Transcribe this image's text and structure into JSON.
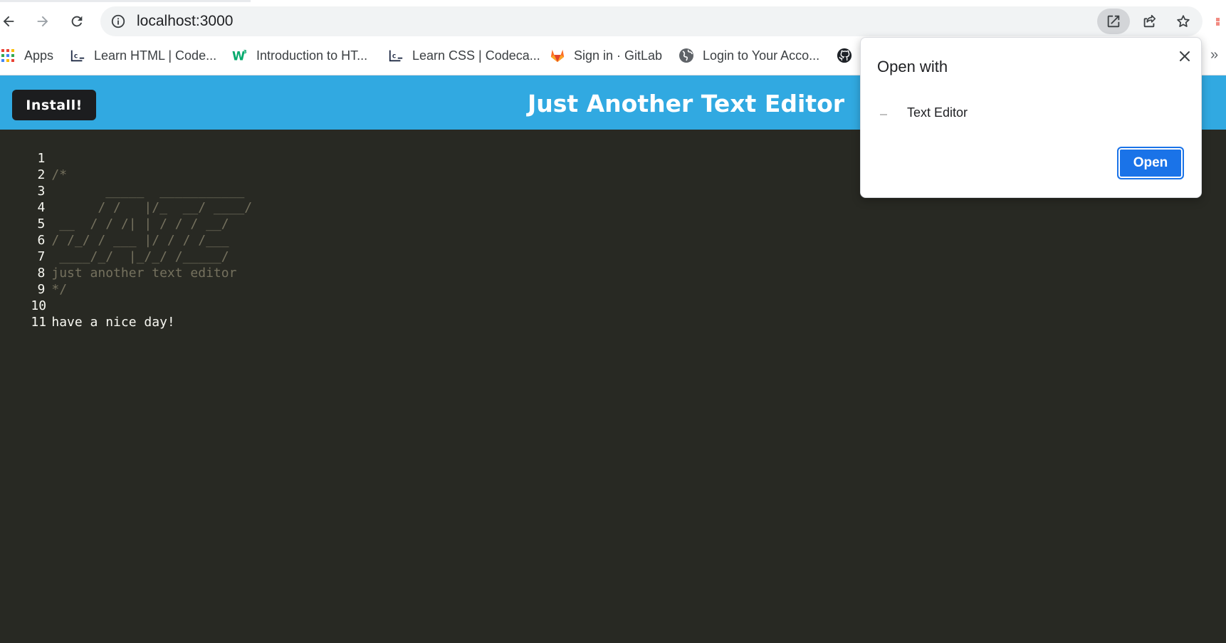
{
  "browser": {
    "url": "localhost:3000",
    "bookmarks": [
      {
        "label": "Apps",
        "icon": "apps-grid-icon"
      },
      {
        "label": "Learn HTML | Code...",
        "icon": "codecademy-icon"
      },
      {
        "label": "Introduction to HT...",
        "icon": "w3schools-icon"
      },
      {
        "label": "Learn CSS | Codeca...",
        "icon": "codecademy-icon"
      },
      {
        "label": "Sign in · GitLab",
        "icon": "gitlab-icon"
      },
      {
        "label": "Login to Your Acco...",
        "icon": "globe-icon"
      }
    ],
    "more_bookmarks": "»"
  },
  "app": {
    "install_label": "Install!",
    "title": "Just Another Text Editor"
  },
  "editor": {
    "lines": [
      {
        "num": "1",
        "text": "",
        "style": "plain"
      },
      {
        "num": "2",
        "text": "/*",
        "style": "comment"
      },
      {
        "num": "3",
        "text": "       _____  ___________",
        "style": "comment"
      },
      {
        "num": "4",
        "text": "      / /   |/_  __/ ____/",
        "style": "comment"
      },
      {
        "num": "5",
        "text": " __  / / /| | / / / __/",
        "style": "comment"
      },
      {
        "num": "6",
        "text": "/ /_/ / ___ |/ / / /___",
        "style": "comment"
      },
      {
        "num": "7",
        "text": " ____/_/  |_/_/ /_____/",
        "style": "comment"
      },
      {
        "num": "8",
        "text": "just another text editor",
        "style": "comment"
      },
      {
        "num": "9",
        "text": "*/",
        "style": "comment"
      },
      {
        "num": "10",
        "text": "",
        "style": "plain"
      },
      {
        "num": "11",
        "text": "have a nice day!",
        "style": "plain"
      }
    ]
  },
  "popup": {
    "title": "Open with",
    "app_name": "Text Editor",
    "open_label": "Open"
  },
  "colors": {
    "header": "#31a9e1",
    "editor_bg": "#282923",
    "comment": "#75715e",
    "plain": "#f8f8f2",
    "accent": "#1a73e8"
  }
}
